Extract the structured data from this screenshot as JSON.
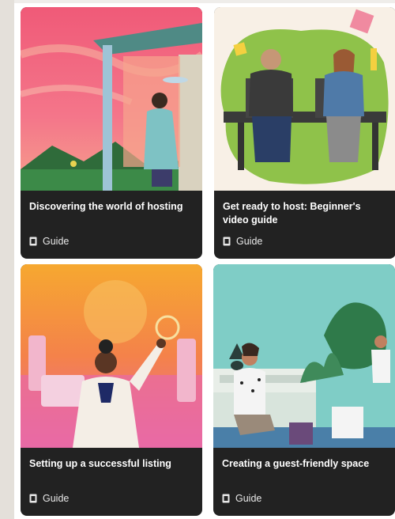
{
  "cards": [
    {
      "title": "Discovering the world of hosting",
      "tag": "Guide",
      "icon": "book-icon"
    },
    {
      "title": "Get ready to host: Beginner's video guide",
      "tag": "Guide",
      "icon": "book-icon"
    },
    {
      "title": "Setting up a successful listing",
      "tag": "Guide",
      "icon": "book-icon"
    },
    {
      "title": "Creating a guest-friendly space",
      "tag": "Guide",
      "icon": "book-icon"
    }
  ],
  "colors": {
    "card_background": "#222222",
    "page_background": "#ffffff"
  }
}
